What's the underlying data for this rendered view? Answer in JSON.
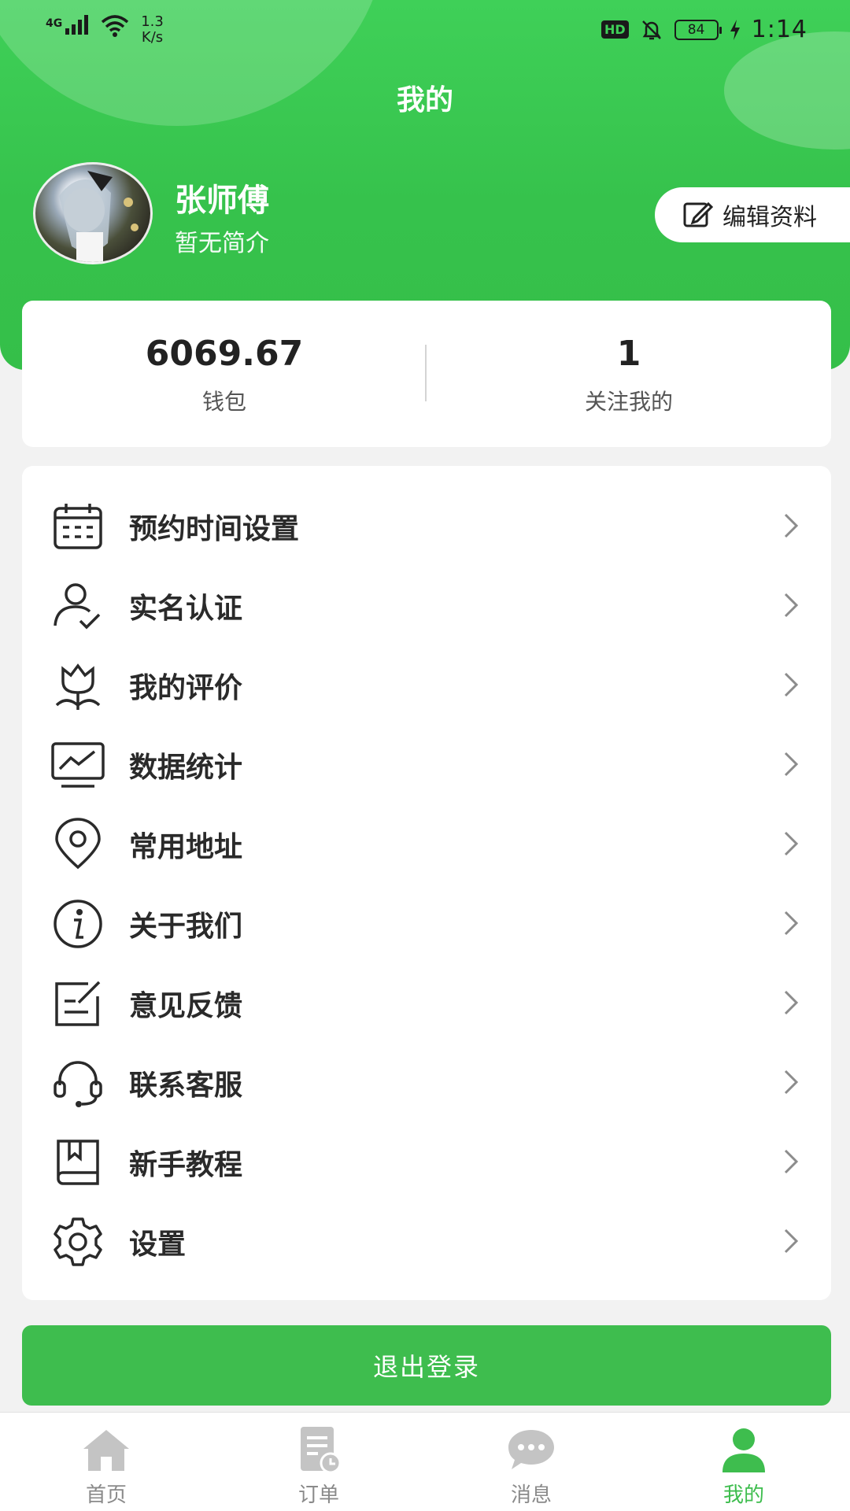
{
  "status_bar": {
    "network": "4G",
    "speed_value": "1.3",
    "speed_unit": "K/s",
    "hd": "HD",
    "battery": "84",
    "time": "1:14"
  },
  "header": {
    "title": "我的"
  },
  "profile": {
    "name": "张师傅",
    "bio": "暂无简介",
    "edit_label": "编辑资料"
  },
  "stats": [
    {
      "value": "6069.67",
      "label": "钱包"
    },
    {
      "value": "1",
      "label": "关注我的"
    }
  ],
  "menu": [
    {
      "label": "预约时间设置",
      "icon": "calendar-icon"
    },
    {
      "label": "实名认证",
      "icon": "user-check-icon"
    },
    {
      "label": "我的评价",
      "icon": "flower-icon"
    },
    {
      "label": "数据统计",
      "icon": "chart-monitor-icon"
    },
    {
      "label": "常用地址",
      "icon": "location-pin-icon"
    },
    {
      "label": "关于我们",
      "icon": "info-icon"
    },
    {
      "label": "意见反馈",
      "icon": "feedback-edit-icon"
    },
    {
      "label": "联系客服",
      "icon": "headset-icon"
    },
    {
      "label": "新手教程",
      "icon": "book-icon"
    },
    {
      "label": "设置",
      "icon": "gear-icon"
    }
  ],
  "logout_label": "退出登录",
  "tabs": [
    {
      "label": "首页",
      "icon": "home-icon",
      "active": false
    },
    {
      "label": "订单",
      "icon": "order-icon",
      "active": false
    },
    {
      "label": "消息",
      "icon": "chat-icon",
      "active": false
    },
    {
      "label": "我的",
      "icon": "profile-icon",
      "active": true
    }
  ],
  "colors": {
    "brand_green": "#3ebd4e",
    "header_green": "#3fd058",
    "inactive_gray": "#8a8a8a"
  }
}
